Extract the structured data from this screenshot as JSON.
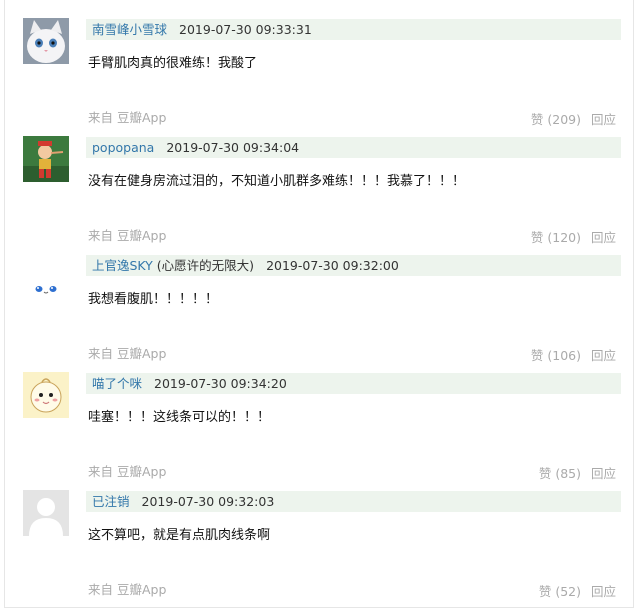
{
  "comments": [
    {
      "author": "南雪峰小雪球",
      "author_note": "",
      "time": "2019-07-30 09:33:31",
      "text": "手臂肌肉真的很难练！我酸了",
      "source_prefix": "来自",
      "source_app": "豆瓣App",
      "like_label": "赞 (209)",
      "reply_label": "回应",
      "avatar_icon": "white-kitten-avatar"
    },
    {
      "author": "popopana",
      "author_note": "",
      "time": "2019-07-30 09:34:04",
      "text": "没有在健身房流过泪的，不知道小肌群多难练！！！我慕了！！！",
      "source_prefix": "来自",
      "source_app": "豆瓣App",
      "like_label": "赞 (120)",
      "reply_label": "回应",
      "avatar_icon": "pinocchio-avatar"
    },
    {
      "author": "上官逸SKY",
      "author_note": " (心愿许的无限大)",
      "time": "2019-07-30 09:32:00",
      "text": "我想看腹肌！！！！！",
      "source_prefix": "来自",
      "source_app": "豆瓣App",
      "like_label": "赞 (106)",
      "reply_label": "回应",
      "avatar_icon": "blue-eyes-avatar"
    },
    {
      "author": "喵了个咪",
      "author_note": "",
      "time": "2019-07-30 09:34:20",
      "text": "哇塞！！！这线条可以的！！！",
      "source_prefix": "来自",
      "source_app": "豆瓣App",
      "like_label": "赞 (85)",
      "reply_label": "回应",
      "avatar_icon": "cartoon-chick-avatar"
    },
    {
      "author": "已注销",
      "author_note": "",
      "time": "2019-07-30 09:32:03",
      "text": "这不算吧，就是有点肌肉线条啊",
      "source_prefix": "来自",
      "source_app": "豆瓣App",
      "like_label": "赞 (52)",
      "reply_label": "回应",
      "avatar_icon": "default-user-avatar"
    }
  ],
  "colors": {
    "author_link": "#3377aa",
    "header_bg": "#edf4ed",
    "meta_gray": "#aaaaaa"
  }
}
